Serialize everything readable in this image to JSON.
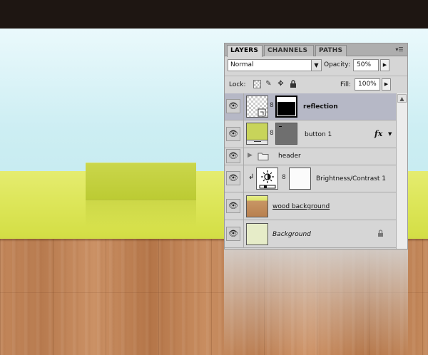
{
  "window": {
    "accent_green": "#c6d343",
    "selected_row_color": "#b6b8c6"
  },
  "layers_panel": {
    "tabs": [
      {
        "label": "LAYERS",
        "active": true
      },
      {
        "label": "CHANNELS",
        "active": false
      },
      {
        "label": "PATHS",
        "active": false
      }
    ],
    "menu_icon": "panel-menu-icon",
    "blend_mode": "Normal",
    "opacity_label": "Opacity:",
    "opacity_value": "50%",
    "lock_label": "Lock:",
    "fill_label": "Fill:",
    "fill_value": "100%",
    "layers": [
      {
        "name": "reflection",
        "visible": true,
        "selected": true,
        "has_mask": true,
        "icons": [
          "eye-icon",
          "link-icon"
        ]
      },
      {
        "name": "button 1",
        "visible": true,
        "selected": false,
        "has_mask": true,
        "fx": "fx",
        "icons": [
          "eye-icon",
          "link-icon",
          "fx-icon"
        ]
      },
      {
        "name": "header",
        "visible": true,
        "type": "group",
        "icons": [
          "eye-icon",
          "triangle-right-icon",
          "folder-icon"
        ]
      },
      {
        "name": "Brightness/Contrast 1",
        "visible": true,
        "type": "adjustment",
        "clipped": true,
        "icons": [
          "eye-icon",
          "clip-arrow-icon",
          "sun-icon",
          "link-icon"
        ]
      },
      {
        "name": "wood background",
        "visible": true
      },
      {
        "name": "Background",
        "visible": true,
        "locked": true,
        "icons": [
          "eye-icon",
          "lock-icon"
        ]
      }
    ]
  }
}
